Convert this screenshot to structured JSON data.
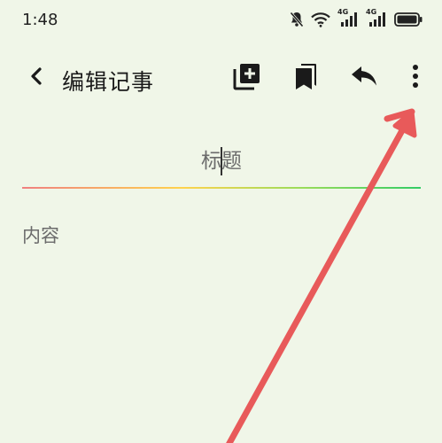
{
  "status_bar": {
    "time": "1:48",
    "icons": [
      "bell-muted-icon",
      "wifi-icon",
      "signal-4g-icon",
      "signal-4g-icon",
      "battery-icon"
    ],
    "network_1": "4G",
    "network_2": "4G"
  },
  "toolbar": {
    "title": "编辑记事",
    "back_icon": "chevron-left-icon",
    "actions": [
      "add-note-icon",
      "bookmarks-icon",
      "undo-icon",
      "more-vert-icon"
    ]
  },
  "editor": {
    "title_placeholder": "标题",
    "title_value": "",
    "content_placeholder": "内容",
    "content_value": ""
  },
  "colors": {
    "background": "#f0f6e8",
    "annotation_arrow": "#e85a5a",
    "divider_start": "#f08080",
    "divider_end": "#33cc66"
  }
}
